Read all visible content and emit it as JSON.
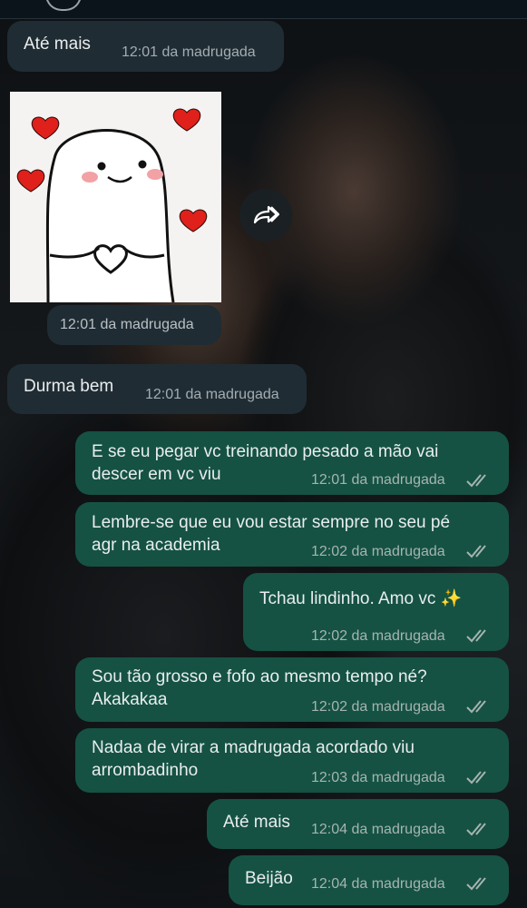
{
  "messages": [
    {
      "text": "Até mais",
      "time": "12:01 da madrugada"
    },
    {
      "time": "12:01 da madrugada"
    },
    {
      "text": "Durma bem",
      "time": "12:01 da madrugada"
    },
    {
      "text": "E se eu pegar vc treinando pesado a mão vai\ndescer em vc viu",
      "time": "12:01 da madrugada"
    },
    {
      "text": "Lembre-se que eu vou estar sempre no seu pé\nagr na academia",
      "time": "12:02 da madrugada"
    },
    {
      "text": "Tchau lindinho. Amo vc ✨",
      "time": "12:02 da madrugada"
    },
    {
      "text": "Sou tão grosso e fofo ao mesmo tempo né?\nAkakakaa",
      "time": "12:02 da madrugada"
    },
    {
      "text": "Nadaa de virar a madrugada acordado viu\narrombadinho",
      "time": "12:03 da madrugada"
    },
    {
      "text": "Até mais",
      "time": "12:04 da madrugada"
    },
    {
      "text": "Beijão",
      "time": "12:04 da madrugada"
    }
  ],
  "icons": {
    "forward": "forward-icon",
    "read_receipt": "double-check-icon",
    "sticker": "flork-heart-sticker"
  },
  "colors": {
    "incoming_bubble": "#202c33",
    "outgoing_bubble": "#155243",
    "read_ticks": "#a6b4b0",
    "heart": "#e0201b"
  }
}
